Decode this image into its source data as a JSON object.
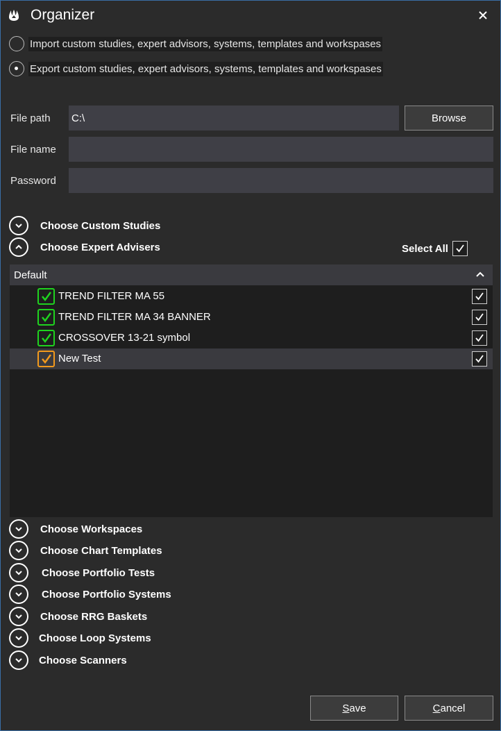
{
  "window": {
    "title": "Organizer"
  },
  "mode": {
    "options": [
      {
        "label": "Import custom studies, expert advisors, systems, templates and workspases",
        "checked": false
      },
      {
        "label": "Export custom studies, expert advisors, systems, templates and workspases",
        "checked": true
      }
    ]
  },
  "form": {
    "file_path_label": "File path",
    "file_path_value": "C:\\",
    "browse_label": "Browse",
    "file_name_label": "File name",
    "file_name_value": "",
    "password_label": "Password",
    "password_value": ""
  },
  "sections": {
    "custom_studies": "Choose Custom Studies",
    "expert_advisers": "Choose Expert Advisers",
    "workspaces": "Choose Workspaces",
    "chart_templates": "Choose Chart Templates",
    "portfolio_tests": "Choose Portfolio Tests",
    "portfolio_systems": "Choose Portfolio Systems",
    "rrg_baskets": "Choose RRG Baskets",
    "loop_systems": "Choose Loop Systems",
    "scanners": "Choose Scanners"
  },
  "select_all": {
    "label": "Select All",
    "checked": true
  },
  "group": {
    "title": "Default",
    "items": [
      {
        "name": "TREND FILTER MA 55",
        "status": "ok",
        "checked": true
      },
      {
        "name": "TREND FILTER MA 34 BANNER",
        "status": "ok",
        "checked": true
      },
      {
        "name": "CROSSOVER 13-21 symbol",
        "status": "ok",
        "checked": true
      },
      {
        "name": "New Test",
        "status": "warning",
        "checked": true
      }
    ]
  },
  "footer": {
    "save_label": "Save",
    "cancel_label": "Cancel"
  },
  "colors": {
    "ok": "#1fd31f",
    "warning": "#f39a1c",
    "background": "#2b2b2b",
    "field": "#3f3f46",
    "panel": "#1e1e1e",
    "border": "#3a6ea5"
  },
  "icons": {
    "app": "app-logo-icon",
    "close": "close-icon",
    "chevron_down": "chevron-down-icon",
    "chevron_up": "chevron-up-icon",
    "check": "checkmark-icon"
  }
}
